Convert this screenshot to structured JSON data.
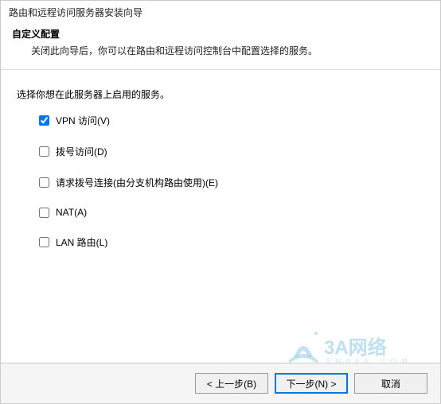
{
  "title_bar": "路由和远程访问服务器安装向导",
  "header": {
    "title": "自定义配置",
    "description": "关闭此向导后，你可以在路由和远程访问控制台中配置选择的服务。"
  },
  "prompt": "选择你想在此服务器上启用的服务。",
  "options": [
    {
      "label": "VPN 访问(V)",
      "checked": true
    },
    {
      "label": "拨号访问(D)",
      "checked": false
    },
    {
      "label": "请求拨号连接(由分支机构路由使用)(E)",
      "checked": false
    },
    {
      "label": "NAT(A)",
      "checked": false
    },
    {
      "label": "LAN 路由(L)",
      "checked": false
    }
  ],
  "buttons": {
    "back": "< 上一步(B)",
    "next": "下一步(N) >",
    "cancel": "取消"
  },
  "watermark": {
    "text": "3A网络",
    "color": "#3aa0d8"
  }
}
